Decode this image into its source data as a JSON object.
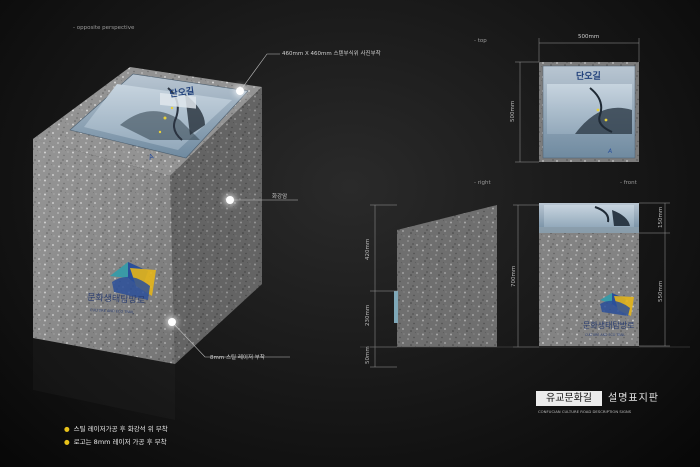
{
  "views": {
    "opposite": "- opposite perspective",
    "top": "- top",
    "right": "- right",
    "front": "- front"
  },
  "callouts": {
    "photo": "460mm X 460mm 스텐부식위 사진부착",
    "stone": "화강암",
    "laser": "8mm 스틸 레이저 부착"
  },
  "dimensions": {
    "top_width": "500mm",
    "top_depth": "500mm",
    "right_420": "420mm",
    "right_230": "230mm",
    "right_50": "50mm",
    "right_700": "700mm",
    "front_150": "150mm",
    "front_550": "550mm"
  },
  "panel": {
    "sign_title": "단오길"
  },
  "logo": {
    "korean": "문화생태탐방로",
    "english": "CULTURE AND ECO TRAIL"
  },
  "notes": [
    "스틸 레이저가공 후 화강석 위 부착",
    "로고는 8mm 레이저 가공 후 부착"
  ],
  "title": {
    "left": "유교문화길",
    "right": "설명표지판",
    "english": "CONFUCIAN CULTURE ROAD DESCRIPTION SIGNS"
  },
  "colors": {
    "bullet": "#e8c21a",
    "panel_sky": "#8fa6b8",
    "logo_blue": "#2a4f9a",
    "logo_yellow": "#e4b51a",
    "logo_teal": "#3a9aa6"
  }
}
